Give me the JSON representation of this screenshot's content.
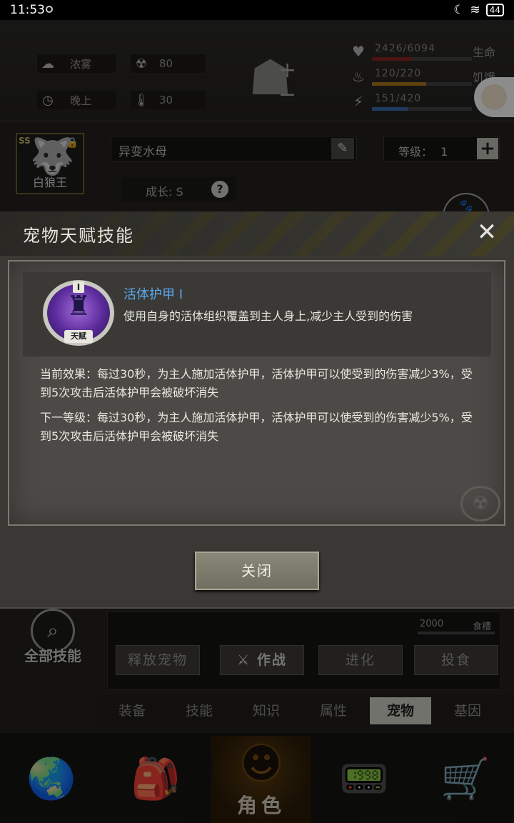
{
  "status_bar": {
    "time": "11:53",
    "battery": "44"
  },
  "environment": {
    "weather": "浓雾",
    "radiation": "80",
    "time_of_day": "晚上",
    "temperature": "30"
  },
  "stats": [
    {
      "icon": "heart-pulse-icon",
      "value": "2426/6094",
      "label": "生命",
      "fraction": 0.398,
      "color": "#8a2424"
    },
    {
      "icon": "food-icon",
      "value": "120/220",
      "label": "饥饿",
      "fraction": 0.545,
      "color": "#b07820"
    },
    {
      "icon": "energy-icon",
      "value": "151/420",
      "label": "",
      "fraction": 0.36,
      "color": "#3a6ab0"
    }
  ],
  "pet": {
    "grade": "SS",
    "name": "白狼王",
    "field_name": "异变水母",
    "level_label": "等级：",
    "level_value": "1",
    "growth": "成长: S"
  },
  "modal": {
    "title": "宠物天赋技能",
    "badge_numeral": "I",
    "badge_tag": "天赋",
    "skill_name": "活体护甲 I",
    "skill_desc": "使用自身的活体组织覆盖到主人身上,减少主人受到的伤害",
    "current_effect": "当前效果：每过30秒，为主人施加活体护甲，活体护甲可以使受到的伤害减少3%，受到5次攻击后活体护甲会被破坏消失",
    "next_level": "下一等级：每过30秒，为主人施加活体护甲，活体护甲可以使受到的伤害减少5%，受到5次攻击后活体护甲会被破坏消失",
    "close_label": "关闭"
  },
  "lower": {
    "all_skills": "全部技能",
    "food_value": "2000",
    "food_label": "食槽",
    "actions": [
      "释放宠物",
      "作战",
      "进化",
      "投食"
    ]
  },
  "subtabs": [
    "装备",
    "技能",
    "知识",
    "属性",
    "宠物",
    "基因"
  ],
  "bottom_nav": {
    "selected_label": "角色"
  }
}
